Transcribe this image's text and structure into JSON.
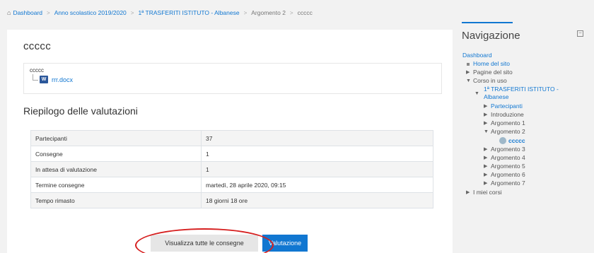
{
  "breadcrumb": {
    "items": [
      "Dashboard",
      "Anno scolastico 2019/2020",
      "1ª TRASFERITI ISTITUTO - Albanese",
      "Argomento 2"
    ],
    "current": "ccccc"
  },
  "main": {
    "title": "ccccc",
    "intro_text": "ccccc",
    "attachment": "rrr.docx",
    "grading": {
      "title": "Riepilogo delle valutazioni",
      "rows": [
        {
          "label": "Partecipanti",
          "value": "37"
        },
        {
          "label": "Consegne",
          "value": "1"
        },
        {
          "label": "In attesa di valutazione",
          "value": "1"
        },
        {
          "label": "Termine consegne",
          "value": "martedì, 28 aprile 2020, 09:15"
        },
        {
          "label": "Tempo rimasto",
          "value": "18 giorni 18 ore"
        }
      ]
    },
    "buttons": {
      "view_all": "Visualizza tutte le consegne",
      "grade": "Valutazione"
    }
  },
  "navigation": {
    "title": "Navigazione",
    "items": [
      {
        "label": "Dashboard"
      },
      {
        "label": "Home del sito"
      },
      {
        "label": "Pagine del sito"
      },
      {
        "label": "Corso in uso"
      },
      {
        "label": "1ª TRASFERITI ISTITUTO -"
      },
      {
        "label": "Albanese"
      },
      {
        "label": "Partecipanti"
      },
      {
        "label": "Introduzione"
      },
      {
        "label": "Argomento 1"
      },
      {
        "label": "Argomento 2"
      },
      {
        "label": "ccccc"
      },
      {
        "label": "Argomento 3"
      },
      {
        "label": "Argomento 4"
      },
      {
        "label": "Argomento 5"
      },
      {
        "label": "Argomento 6"
      },
      {
        "label": "Argomento 7"
      },
      {
        "label": "I miei corsi"
      }
    ]
  },
  "colors": {
    "link": "#1177d1",
    "primary_button": "#1177d1",
    "annotation": "#d62020"
  },
  "icons": [
    "home-icon",
    "word-file-icon",
    "assignment-icon",
    "collapse-block-icon"
  ]
}
